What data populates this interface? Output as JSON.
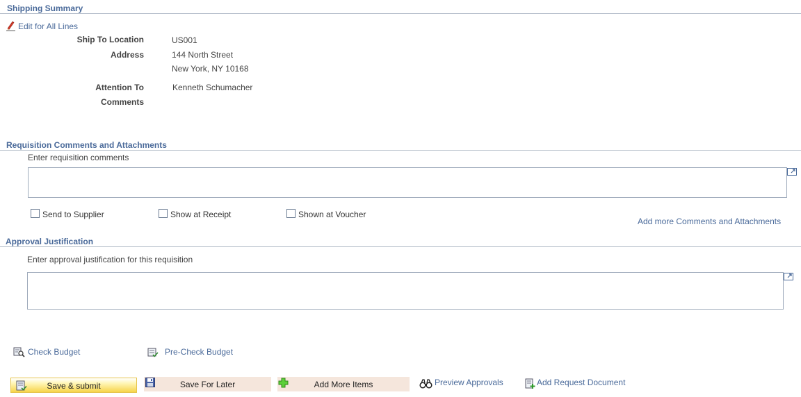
{
  "shipping": {
    "title": "Shipping Summary",
    "edit_link": "Edit for All Lines",
    "ship_to_label": "Ship To Location",
    "ship_to_value": "US001",
    "address_label": "Address",
    "address_line1": "144 North Street",
    "address_line2": "New York, NY  10168",
    "attention_label": "Attention To",
    "attention_value": "Kenneth Schumacher",
    "comments_label": "Comments"
  },
  "comments": {
    "title": "Requisition Comments and Attachments",
    "prompt": "Enter requisition comments",
    "comment_value": "",
    "send_supplier": "Send to Supplier",
    "show_receipt": "Show at Receipt",
    "shown_voucher": "Shown at Voucher",
    "add_more_link": "Add more Comments and Attachments"
  },
  "approval": {
    "title": "Approval Justification",
    "prompt": "Enter approval justification for this requisition",
    "justification_value": ""
  },
  "budget": {
    "check_label": "Check Budget",
    "precheck_label": "Pre-Check Budget"
  },
  "actions": {
    "save_submit": "Save & submit",
    "save_later": "Save For Later",
    "add_items": "Add More Items",
    "preview_approvals": "Preview Approvals",
    "add_request_doc": "Add Request Document"
  },
  "colors": {
    "section_title": "#4a6a9a",
    "button_bg": "#f5e6dc",
    "primary_button": "#f7d44a"
  }
}
